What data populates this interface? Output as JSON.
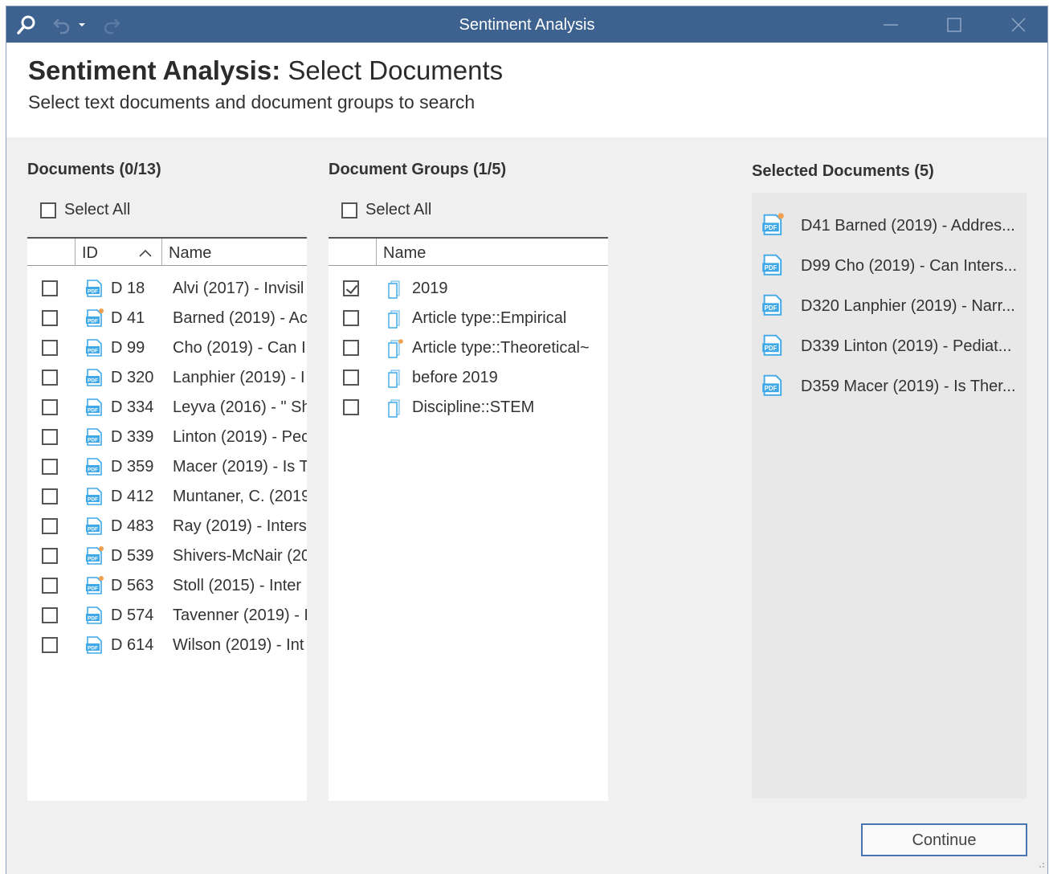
{
  "window": {
    "title": "Sentiment Analysis"
  },
  "header": {
    "title_bold": "Sentiment Analysis:",
    "title_rest": "Select Documents",
    "subtitle": "Select text documents and document groups to search"
  },
  "documents": {
    "title": "Documents (0/13)",
    "select_all": "Select All",
    "col_id": "ID",
    "col_name": "Name",
    "rows": [
      {
        "id": "D 18",
        "name": "Alvi (2017) - Invisil",
        "memo": false
      },
      {
        "id": "D 41",
        "name": "Barned (2019) - Ac",
        "memo": true
      },
      {
        "id": "D 99",
        "name": "Cho (2019) - Can I",
        "memo": false
      },
      {
        "id": "D 320",
        "name": "Lanphier (2019) - I",
        "memo": false
      },
      {
        "id": "D 334",
        "name": "Leyva (2016) - \" Sh",
        "memo": false
      },
      {
        "id": "D 339",
        "name": "Linton (2019) - Pec",
        "memo": false
      },
      {
        "id": "D 359",
        "name": "Macer (2019) - Is T",
        "memo": false
      },
      {
        "id": "D 412",
        "name": "Muntaner, C. (2019",
        "memo": false
      },
      {
        "id": "D 483",
        "name": "Ray (2019) - Inters",
        "memo": false
      },
      {
        "id": "D 539",
        "name": "Shivers-McNair (20",
        "memo": true
      },
      {
        "id": "D 563",
        "name": "Stoll (2015) - Inter",
        "memo": true
      },
      {
        "id": "D 574",
        "name": "Tavenner (2019) - I",
        "memo": false
      },
      {
        "id": "D 614",
        "name": "Wilson (2019) - Int",
        "memo": false
      }
    ]
  },
  "groups": {
    "title": "Document Groups (1/5)",
    "select_all": "Select All",
    "col_name": "Name",
    "rows": [
      {
        "name": "2019",
        "checked": true,
        "memo": false
      },
      {
        "name": "Article type::Empirical",
        "checked": false,
        "memo": false
      },
      {
        "name": "Article type::Theoretical~",
        "checked": false,
        "memo": true
      },
      {
        "name": "before 2019",
        "checked": false,
        "memo": false
      },
      {
        "name": "Discipline::STEM",
        "checked": false,
        "memo": false
      }
    ]
  },
  "selected": {
    "title": "Selected Documents (5)",
    "items": [
      {
        "label": "D41 Barned (2019) - Addres...",
        "memo": true
      },
      {
        "label": "D99 Cho (2019) - Can Inters...",
        "memo": false
      },
      {
        "label": "D320 Lanphier (2019) - Narr...",
        "memo": false
      },
      {
        "label": "D339 Linton (2019) - Pediat...",
        "memo": false
      },
      {
        "label": "D359 Macer (2019) - Is Ther...",
        "memo": false
      }
    ]
  },
  "buttons": {
    "continue": "Continue"
  },
  "colors": {
    "titlebar": "#3d6290",
    "pdf_icon": "#3fa9e8",
    "memo_dot": "#f0a050",
    "accent_border": "#4a74ad"
  }
}
